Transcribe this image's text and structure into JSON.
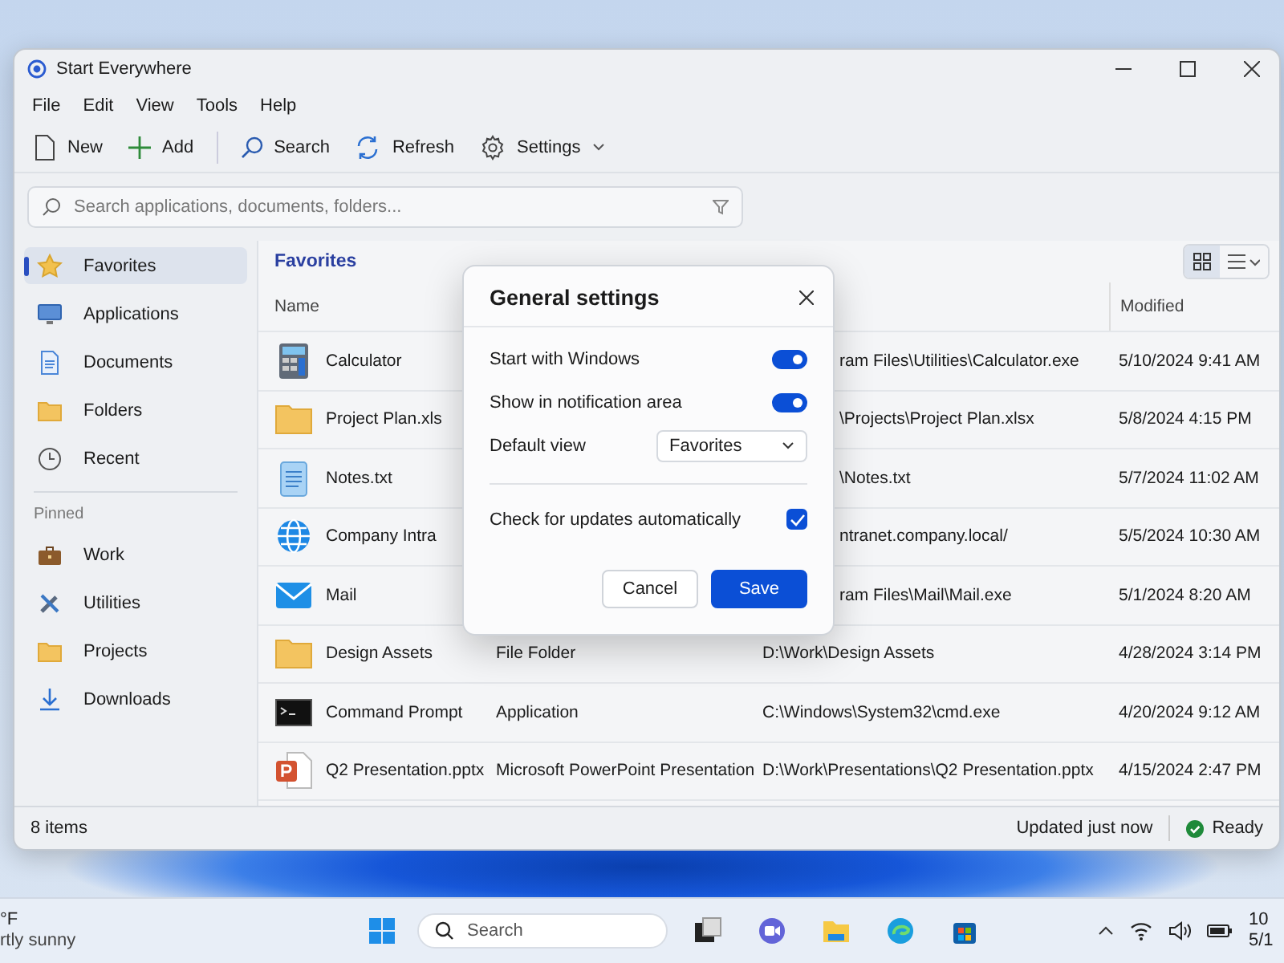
{
  "window": {
    "title": "Start Everywhere",
    "menu": [
      "File",
      "Edit",
      "View",
      "Tools",
      "Help"
    ],
    "toolbar": [
      {
        "kind": "new",
        "label": "New"
      },
      {
        "kind": "add",
        "label": "Add"
      },
      {
        "kind": "search",
        "label": "Search"
      },
      {
        "kind": "refresh",
        "label": "Refresh"
      },
      {
        "kind": "settings",
        "label": "Settings"
      }
    ],
    "search": {
      "placeholder": "Search applications, documents, folders..."
    },
    "sidebar": {
      "items": [
        {
          "kind": "star",
          "label": "Favorites",
          "selected": true
        },
        {
          "kind": "monitor",
          "label": "Applications",
          "selected": false
        },
        {
          "kind": "document",
          "label": "Documents",
          "selected": false
        },
        {
          "kind": "folder",
          "label": "Folders",
          "selected": false
        },
        {
          "kind": "clock",
          "label": "Recent",
          "selected": false
        }
      ],
      "pinned_heading": "Pinned",
      "pinned": [
        {
          "kind": "briefcase",
          "label": "Work",
          "selected": false
        },
        {
          "kind": "tools",
          "label": "Utilities",
          "selected": false
        },
        {
          "kind": "folder",
          "label": "Projects",
          "selected": false
        },
        {
          "kind": "download",
          "label": "Downloads",
          "selected": false
        }
      ]
    },
    "content": {
      "heading": "Favorites",
      "views": [
        {
          "kind": "grid",
          "selected": true
        },
        {
          "kind": "list",
          "selected": false
        }
      ]
    },
    "table": {
      "columns": {
        "name": "Name",
        "modified": "Modified"
      },
      "rows": [
        {
          "kind": "calculator",
          "name": "Calculator",
          "path": "ram Files\\Utilities\\Calculator.exe",
          "modified": "5/10/2024 9:41 AM"
        },
        {
          "kind": "folder",
          "name": "Project Plan.xls",
          "path": "\\Projects\\Project Plan.xlsx",
          "modified": "5/8/2024 4:15 PM"
        },
        {
          "kind": "notes",
          "name": "Notes.txt",
          "path": "\\Notes.txt",
          "modified": "5/7/2024 11:02 AM"
        },
        {
          "kind": "globe",
          "name": "Company Intra",
          "path": "ntranet.company.local/",
          "modified": "5/5/2024 10:30 AM"
        },
        {
          "kind": "mail",
          "name": "Mail",
          "path": "ram Files\\Mail\\Mail.exe",
          "modified": "5/1/2024 8:20 AM"
        },
        {
          "kind": "folder",
          "name": "Design Assets",
          "type": "File Folder",
          "path": "D:\\Work\\Design Assets",
          "modified": "4/28/2024 3:14 PM"
        },
        {
          "kind": "terminal",
          "name": "Command Prompt",
          "type": "Application",
          "path": "C:\\Windows\\System32\\cmd.exe",
          "modified": "4/20/2024 9:12 AM"
        },
        {
          "kind": "powerpoint",
          "name": "Q2 Presentation.pptx",
          "type": "Microsoft PowerPoint Presentation",
          "path": "D:\\Work\\Presentations\\Q2 Presentation.pptx",
          "modified": "4/15/2024 2:47 PM"
        }
      ]
    },
    "status_bar": {
      "count": "8 items",
      "updated": "Updated just now",
      "state": "Ready"
    }
  },
  "dialog": {
    "title": "General settings",
    "settings": [
      {
        "kind": "toggle",
        "label": "Start with Windows",
        "on": true
      },
      {
        "kind": "toggle",
        "label": "Show in notification area",
        "on": true
      },
      {
        "kind": "dropdown",
        "label": "Default view",
        "value": "Favorites"
      },
      {
        "kind": "divider"
      },
      {
        "kind": "checkbox",
        "label": "Check for updates automatically",
        "checked": true
      }
    ],
    "buttons": [
      {
        "label": "Cancel",
        "primary": false
      },
      {
        "label": "Save",
        "primary": true
      }
    ]
  },
  "taskbar": {
    "weather": {
      "temp": "°F",
      "condition": "rtly sunny"
    },
    "search": {
      "placeholder": "Search"
    },
    "apps": [
      {
        "kind": "taskview"
      },
      {
        "kind": "chat"
      },
      {
        "kind": "explorer"
      },
      {
        "kind": "edge"
      },
      {
        "kind": "store"
      }
    ],
    "clock": {
      "time": "10",
      "date": "5/1"
    }
  }
}
